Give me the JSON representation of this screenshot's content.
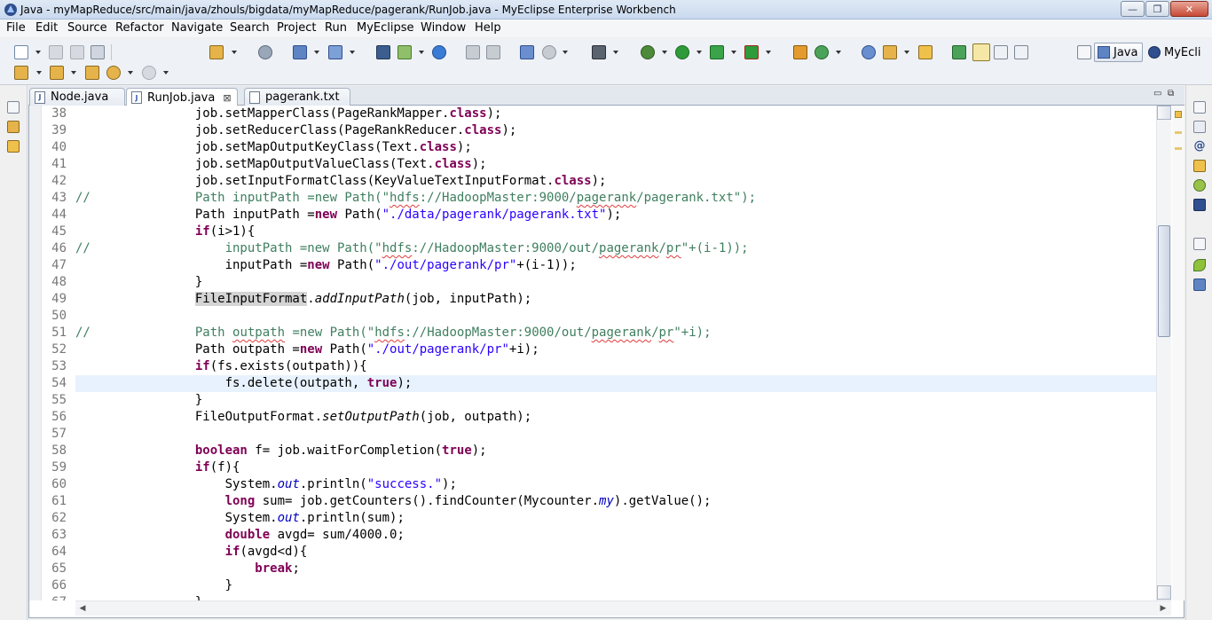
{
  "window": {
    "title": "Java - myMapReduce/src/main/java/zhouls/bigdata/myMapReduce/pagerank/RunJob.java - MyEclipse Enterprise Workbench",
    "minimize": "—",
    "maximize": "❐",
    "close": "✕"
  },
  "menu": [
    "File",
    "Edit",
    "Source",
    "Refactor",
    "Navigate",
    "Search",
    "Project",
    "Run",
    "MyEclipse",
    "Window",
    "Help"
  ],
  "perspectives": {
    "java": "Java",
    "myeclipse": "MyEcli"
  },
  "tabs": [
    {
      "label": "Node.java",
      "icon": "J",
      "active": false
    },
    {
      "label": "RunJob.java",
      "icon": "J",
      "active": true,
      "close": "⊠"
    },
    {
      "label": "pagerank.txt",
      "icon": "",
      "active": false
    }
  ],
  "view_controls": {
    "minimize": "▭",
    "maximize": "⧉"
  },
  "editor": {
    "current_line": 54,
    "lines": [
      {
        "n": "38",
        "html": "                job.setMapperClass(PageRankMapper.<span class=\"kw\">class</span>);"
      },
      {
        "n": "39",
        "html": "                job.setReducerClass(PageRankReducer.<span class=\"kw\">class</span>);"
      },
      {
        "n": "40",
        "html": "                job.setMapOutputKeyClass(Text.<span class=\"kw\">class</span>);"
      },
      {
        "n": "41",
        "html": "                job.setMapOutputValueClass(Text.<span class=\"kw\">class</span>);"
      },
      {
        "n": "42",
        "html": "                job.setInputFormatClass(KeyValueTextInputFormat.<span class=\"kw\">class</span>);"
      },
      {
        "n": "43",
        "html": "<span class=\"cmt\">//              Path inputPath =new Path(\"<span class=\"sq\">hdfs</span>://HadoopMaster:9000/<span class=\"sq\">pagerank</span>/pagerank.txt\");</span>"
      },
      {
        "n": "44",
        "html": "                Path inputPath =<span class=\"kw\">new</span> Path(<span class=\"str\">\"./data/pagerank/pagerank.txt\"</span>);"
      },
      {
        "n": "45",
        "html": "                <span class=\"kw\">if</span>(i>1){"
      },
      {
        "n": "46",
        "html": "<span class=\"cmt\">//                  inputPath =new Path(\"<span class=\"sq\">hdfs</span>://HadoopMaster:9000/out/<span class=\"sq\">pagerank</span>/<span class=\"sq\">pr</span>\"+(i-1));</span>"
      },
      {
        "n": "47",
        "html": "                    inputPath =<span class=\"kw\">new</span> Path(<span class=\"str\">\"./out/pagerank/pr\"</span>+(i-1));"
      },
      {
        "n": "48",
        "html": "                }"
      },
      {
        "n": "49",
        "html": "                <span class=\"hl\">FileInputFormat</span>.<span class=\"ital\">addInputPath</span>(job, inputPath);"
      },
      {
        "n": "50",
        "html": ""
      },
      {
        "n": "51",
        "html": "<span class=\"cmt\">//              Path <span class=\"sq\">outpath</span> =new Path(\"<span class=\"sq\">hdfs</span>://HadoopMaster:9000/out/<span class=\"sq\">pagerank</span>/<span class=\"sq\">pr</span>\"+i);</span>"
      },
      {
        "n": "52",
        "html": "                Path outpath =<span class=\"kw\">new</span> Path(<span class=\"str\">\"./out/pagerank/pr\"</span>+i);"
      },
      {
        "n": "53",
        "html": "                <span class=\"kw\">if</span>(fs.exists(outpath)){"
      },
      {
        "n": "54",
        "html": "                    fs.delete(outpath, <span class=\"kw\">true</span>);"
      },
      {
        "n": "55",
        "html": "                }"
      },
      {
        "n": "56",
        "html": "                FileOutputFormat.<span class=\"ital\">setOutputPath</span>(job, outpath);"
      },
      {
        "n": "57",
        "html": ""
      },
      {
        "n": "58",
        "html": "                <span class=\"kw\">boolean</span> f= job.waitForCompletion(<span class=\"kw\">true</span>);"
      },
      {
        "n": "59",
        "html": "                <span class=\"kw\">if</span>(f){"
      },
      {
        "n": "60",
        "html": "                    System.<span class=\"fld\">out</span>.println(<span class=\"str\">\"success.\"</span>);"
      },
      {
        "n": "61",
        "html": "                    <span class=\"kw\">long</span> sum= job.getCounters().findCounter(Mycounter.<span class=\"fld\">my</span>).getValue();"
      },
      {
        "n": "62",
        "html": "                    System.<span class=\"fld\">out</span>.println(sum);"
      },
      {
        "n": "63",
        "html": "                    <span class=\"kw\">double</span> avgd= sum/4000.0;"
      },
      {
        "n": "64",
        "html": "                    <span class=\"kw\">if</span>(avgd&lt;d){"
      },
      {
        "n": "65",
        "html": "                        <span class=\"kw\">break</span>;"
      },
      {
        "n": "66",
        "html": "                    }"
      },
      {
        "n": "67",
        "html": "                }"
      }
    ]
  },
  "scroll": {
    "left_arrow": "◀",
    "right_arrow": "▶"
  }
}
